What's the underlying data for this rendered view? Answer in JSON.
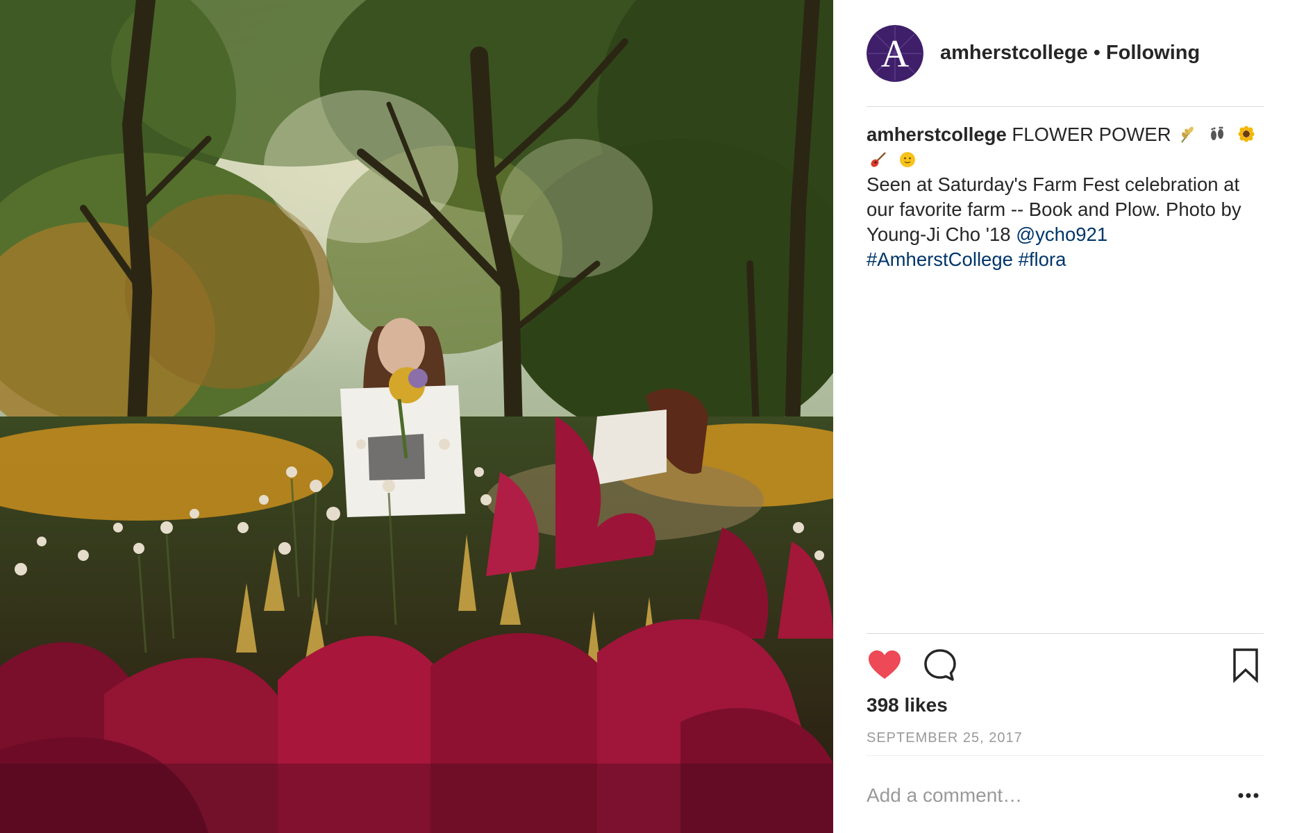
{
  "photo": {
    "alt_subject": "people picking flowers in a garden"
  },
  "header": {
    "avatar_letter": "A",
    "username": "amherstcollege",
    "separator": "•",
    "follow_status": "Following"
  },
  "caption": {
    "username": "amherstcollege",
    "title": "FLOWER POWER",
    "emojis": [
      "wheat-icon",
      "footprints-icon",
      "sunflower-icon",
      "guitar-icon",
      "sun-face-icon"
    ],
    "text_before_mention": "Seen at Saturday's Farm Fest celebration at our favorite farm -- Book and Plow. Photo by Young-Ji Cho '18",
    "mention": "@ycho921",
    "hashtag_1": "#AmherstCollege",
    "hashtag_2": "#flora"
  },
  "actions": {
    "like_icon": "heart-icon",
    "like_state": "liked",
    "like_color": "#ed4956",
    "comment_icon": "comment-icon",
    "save_icon": "bookmark-icon"
  },
  "likes": "398 likes",
  "date": "SEPTEMBER 25, 2017",
  "comment": {
    "placeholder": "Add a comment…",
    "more_icon": "ellipsis-icon"
  },
  "colors": {
    "avatar_bg": "#3f1f69",
    "link": "#003569",
    "text": "#262626",
    "muted": "#999999"
  }
}
